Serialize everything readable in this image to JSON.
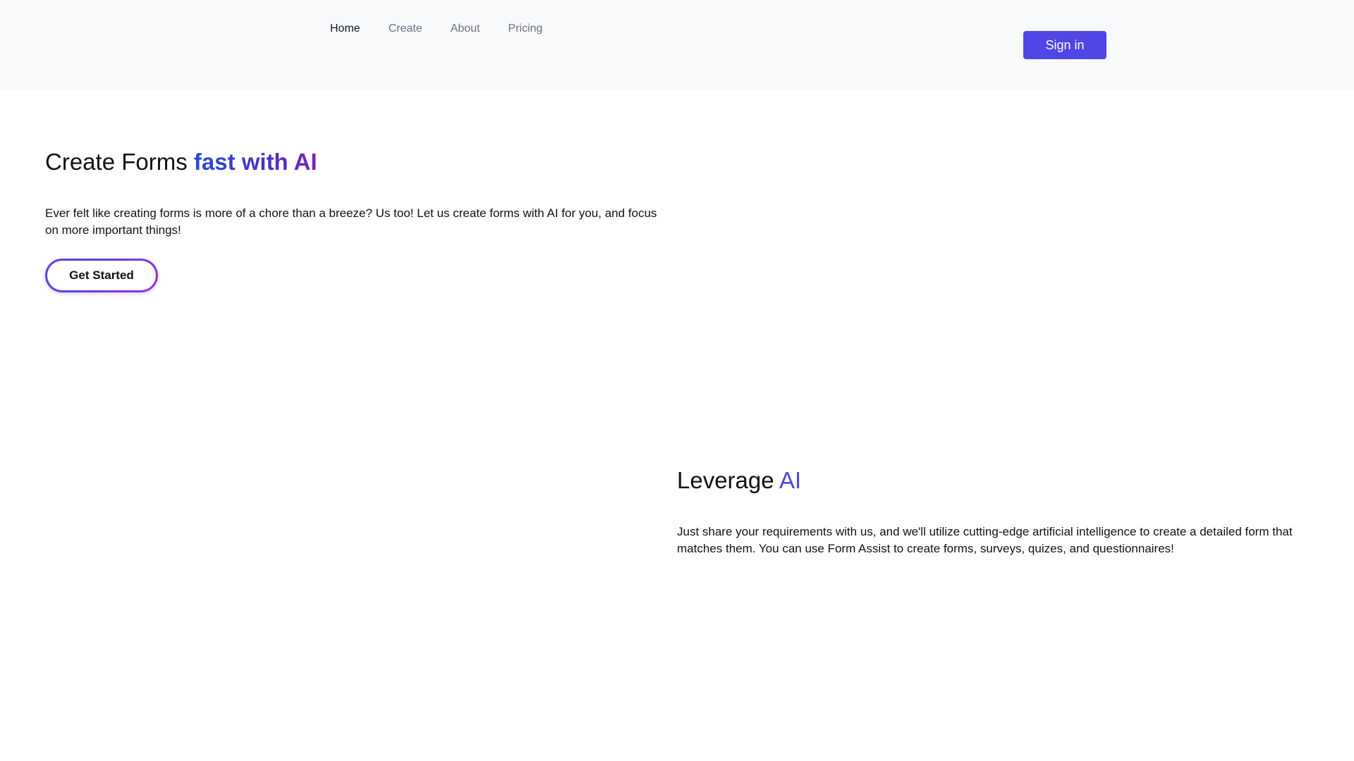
{
  "nav": {
    "items": [
      {
        "label": "Home",
        "active": true
      },
      {
        "label": "Create",
        "active": false
      },
      {
        "label": "About",
        "active": false
      },
      {
        "label": "Pricing",
        "active": false
      }
    ],
    "sign_in_label": "Sign in"
  },
  "hero": {
    "title_plain": "Create Forms ",
    "title_highlight": "fast with AI",
    "description": "Ever felt like creating forms is more of a chore than a breeze? Us too! Let us create forms with AI for you, and focus on more important things!",
    "cta_label": "Get Started"
  },
  "feature": {
    "title_plain": "Leverage ",
    "title_highlight": "AI",
    "description": "Just share your requirements with us, and we'll utilize cutting-edge artificial intelligence to create a detailed form that matches them. You can use Form Assist to create forms, surveys, quizes, and questionnaires!"
  },
  "colors": {
    "brand": "#5046e5",
    "header_bg": "#f8f9fb",
    "nav_inactive": "#6b7280",
    "nav_active": "#111827"
  }
}
